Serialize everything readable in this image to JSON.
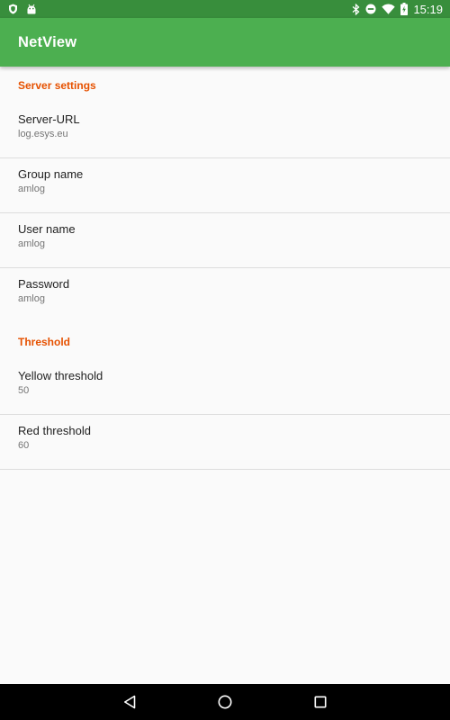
{
  "status_bar": {
    "time": "15:19",
    "left_icons": [
      "shield-icon",
      "android-icon"
    ],
    "right_icons": [
      "bluetooth-icon",
      "do-not-disturb-icon",
      "wifi-icon",
      "battery-charging-icon"
    ]
  },
  "app_bar": {
    "title": "NetView"
  },
  "sections": {
    "server": {
      "header": "Server settings",
      "items": [
        {
          "title": "Server-URL",
          "summary": "log.esys.eu"
        },
        {
          "title": "Group name",
          "summary": "amlog"
        },
        {
          "title": "User name",
          "summary": "amlog"
        },
        {
          "title": "Password",
          "summary": "amlog"
        }
      ]
    },
    "threshold": {
      "header": "Threshold",
      "items": [
        {
          "title": "Yellow threshold",
          "summary": "50"
        },
        {
          "title": "Red threshold",
          "summary": "60"
        }
      ]
    }
  },
  "nav_bar": {
    "buttons": [
      "back-icon",
      "home-icon",
      "recents-icon"
    ]
  },
  "colors": {
    "status_bar": "#388e3c",
    "app_bar": "#4caf50",
    "accent": "#e65100",
    "background": "#fafafa"
  }
}
